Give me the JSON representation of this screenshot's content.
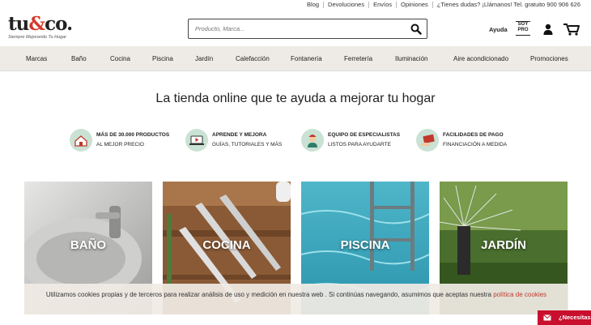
{
  "topbar": {
    "links": [
      "Blog",
      "Devoluciones",
      "Envíos",
      "Opiniones",
      "¿Tienes dudas? ¡Llámanos! Tel. gratuito 900 906 626"
    ]
  },
  "logo": {
    "word_a": "tu",
    "amp": "&",
    "word_b": "co.",
    "tagline": "Siempre Mejorando Tu Hogar"
  },
  "search": {
    "placeholder": "Producto, Marca..."
  },
  "header": {
    "ayuda": "Ayuda",
    "soypro_1": "SOY",
    "soypro_2": "PRO"
  },
  "nav": {
    "items": [
      "Marcas",
      "Baño",
      "Cocina",
      "Piscina",
      "Jardín",
      "Calefacción",
      "Fontanería",
      "Ferretería",
      "Iluminación",
      "Aire acondicionado",
      "Promociones"
    ]
  },
  "headline": "La tienda online que te ayuda a mejorar tu hogar",
  "features": [
    {
      "title": "MÁS DE 30.000 PRODUCTOS",
      "subtitle": "AL MEJOR PRECIO",
      "icon": "house-icon"
    },
    {
      "title": "APRENDE Y MEJORA",
      "subtitle": "GUÍAS, TUTORIALES Y MÁS",
      "icon": "video-laptop-icon"
    },
    {
      "title": "EQUIPO DE ESPECIALISTAS",
      "subtitle": "LISTOS PARA AYUDARTE",
      "icon": "specialist-icon"
    },
    {
      "title": "FACILIDADES DE PAGO",
      "subtitle": "FINANCIACIÓN A MEDIDA",
      "icon": "payment-card-icon"
    }
  ],
  "categories": [
    "BAÑO",
    "COCINA",
    "PISCINA",
    "JARDÍN"
  ],
  "cookie": {
    "text": "Utilizamos cookies propias y de terceros para realizar análisis de uso y medición en nuestra web . Si continúas navegando, asumimos que aceptas nuestra",
    "link": "política de cookies"
  },
  "chat": {
    "label": "¿Necesitas"
  },
  "colors": {
    "accent": "#c8102e",
    "nav_bg": "#eeebe6",
    "feature_icon_bg": "#c9e2d4"
  }
}
